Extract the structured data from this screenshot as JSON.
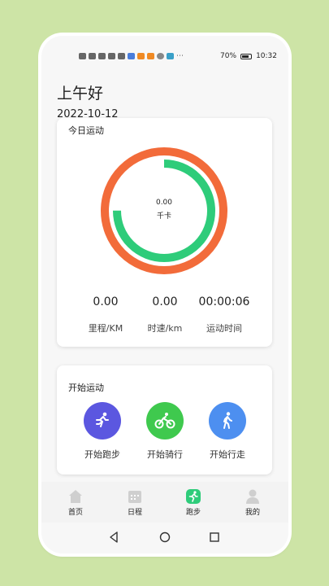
{
  "status": {
    "battery": "70%",
    "time": "10:32"
  },
  "greeting": "上午好",
  "date": "2022-10-12",
  "today": {
    "title": "今日运动",
    "calories_value": "0.00",
    "calories_unit": "千卡",
    "ring_outer_progress": 1.0,
    "ring_inner_progress": 0.75,
    "stats": [
      {
        "value": "0.00",
        "label": "里程/KM"
      },
      {
        "value": "0.00",
        "label": "时速/km"
      },
      {
        "value": "00:00:06",
        "label": "运动时间"
      }
    ]
  },
  "start": {
    "title": "开始运动",
    "actions": [
      {
        "label": "开始跑步",
        "icon": "running-icon",
        "color": "#5b57e0"
      },
      {
        "label": "开始骑行",
        "icon": "cycling-icon",
        "color": "#3fc94e"
      },
      {
        "label": "开始行走",
        "icon": "walking-icon",
        "color": "#4d8ff0"
      }
    ]
  },
  "tabs": [
    {
      "label": "首页",
      "icon": "home-icon",
      "active": false
    },
    {
      "label": "日程",
      "icon": "calendar-icon",
      "active": false
    },
    {
      "label": "跑步",
      "icon": "running-icon",
      "active": true
    },
    {
      "label": "我的",
      "icon": "profile-icon",
      "active": false
    }
  ],
  "colors": {
    "ring_outer": "#f26b3a",
    "ring_inner": "#2ecc7a",
    "active_tab": "#2ecc7a",
    "inactive_tab": "#cfcfcf"
  }
}
